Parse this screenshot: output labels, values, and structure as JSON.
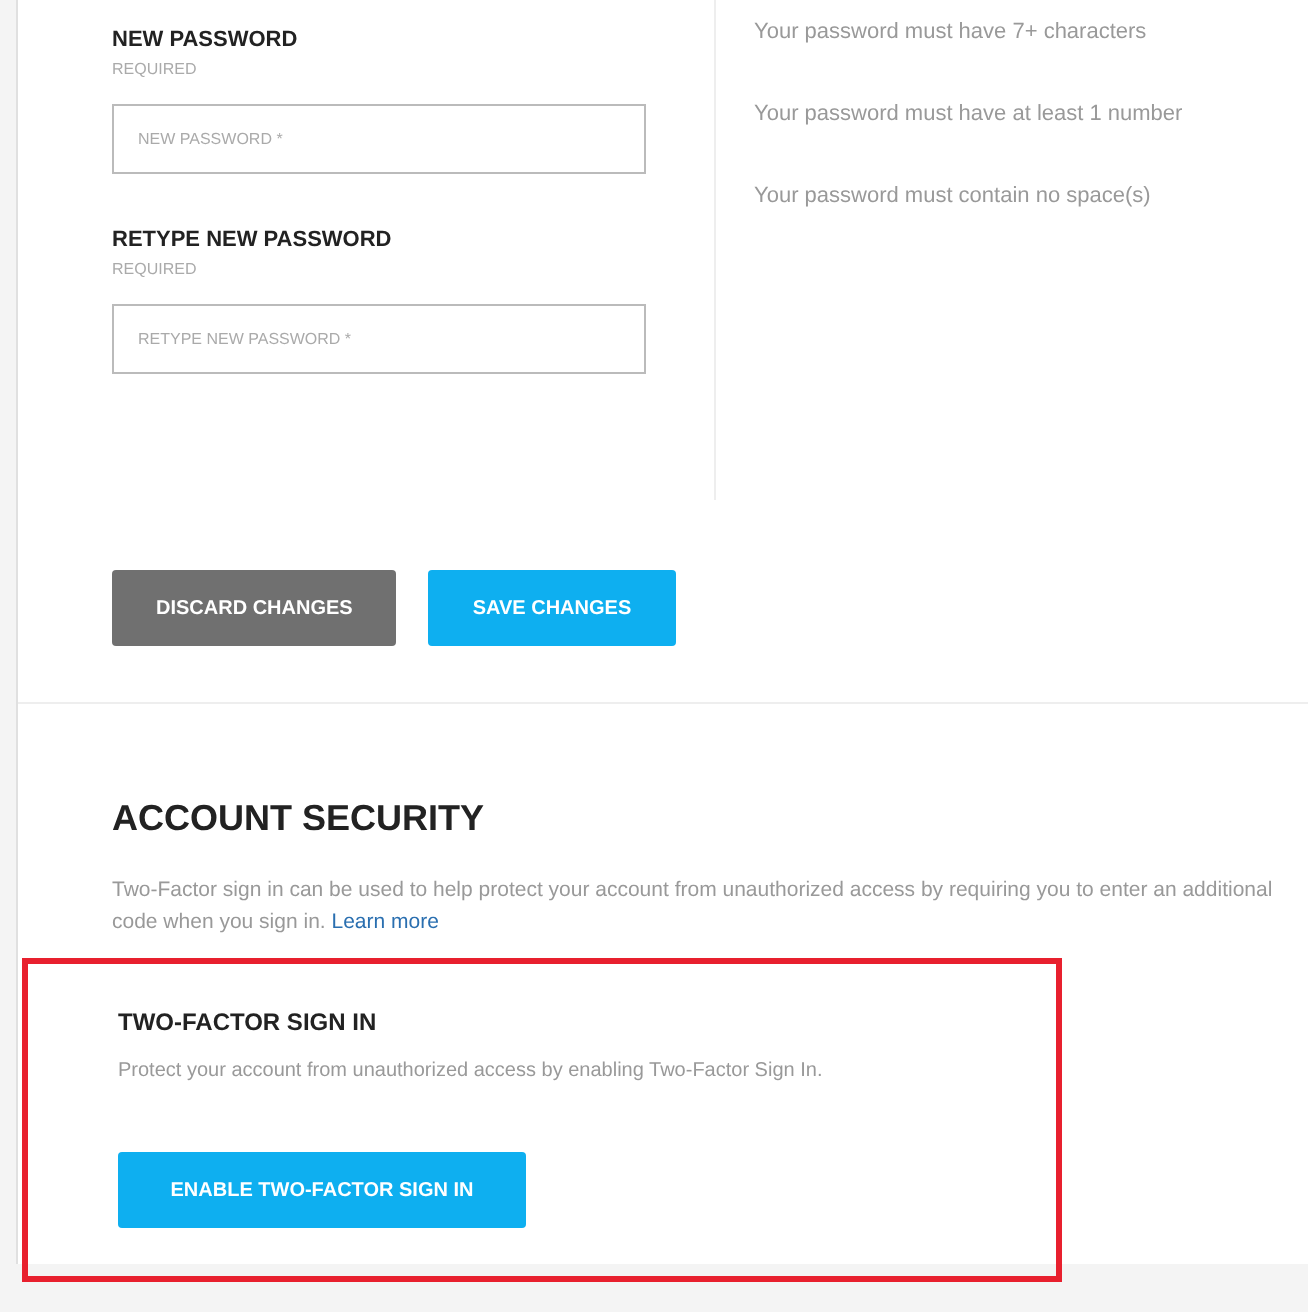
{
  "password_fields": [
    {
      "label": "NEW PASSWORD",
      "note": "REQUIRED",
      "placeholder": "NEW PASSWORD *"
    },
    {
      "label": "RETYPE NEW PASSWORD",
      "note": "REQUIRED",
      "placeholder": "RETYPE NEW PASSWORD *"
    }
  ],
  "rules": [
    "Your password must have 7+ characters",
    "Your password must have at least 1 number",
    "Your password must contain no space(s)"
  ],
  "buttons": [
    {
      "label": "DISCARD CHANGES",
      "kind": "secondary"
    },
    {
      "label": "SAVE CHANGES",
      "kind": "primary"
    }
  ],
  "account_security": {
    "title": "ACCOUNT SECURITY",
    "description": "Two-Factor sign in can be used to help protect your account from unauthorized access by requiring you to enter an additional code when you sign in.",
    "link": "Learn more"
  },
  "two_factor": {
    "highlighted": true,
    "title": "TWO-FACTOR SIGN IN",
    "description": "Protect your account from unauthorized access by enabling Two-Factor Sign In.",
    "button": "ENABLE TWO-FACTOR SIGN IN"
  }
}
